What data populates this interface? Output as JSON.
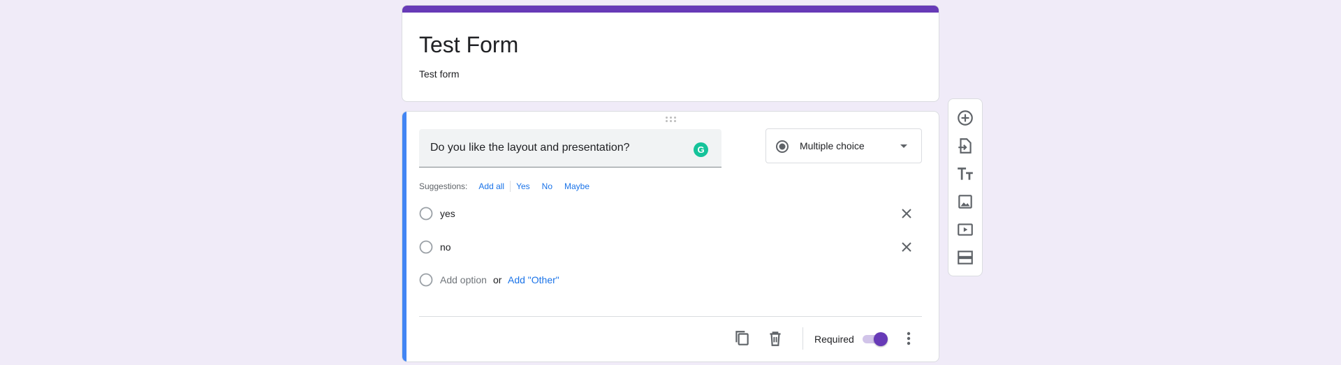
{
  "form": {
    "title": "Test Form",
    "description": "Test form"
  },
  "question": {
    "text": "Do you like the layout and presentation?",
    "type": "Multiple choice",
    "suggestions_label": "Suggestions:",
    "suggestions": [
      "Add all",
      "Yes",
      "No",
      "Maybe"
    ],
    "options": [
      "yes",
      "no"
    ],
    "add_option": "Add option",
    "or": "or",
    "add_other": "Add \"Other\"",
    "required_label": "Required",
    "required": true
  },
  "colors": {
    "accent": "#673ab7",
    "active_card_bar": "#4285f4",
    "background": "#f0ebf8",
    "link": "#1a73e8"
  },
  "toolbar": {
    "icons": [
      "add-question-icon",
      "import-questions-icon",
      "add-title-icon",
      "add-image-icon",
      "add-video-icon",
      "add-section-icon"
    ]
  }
}
